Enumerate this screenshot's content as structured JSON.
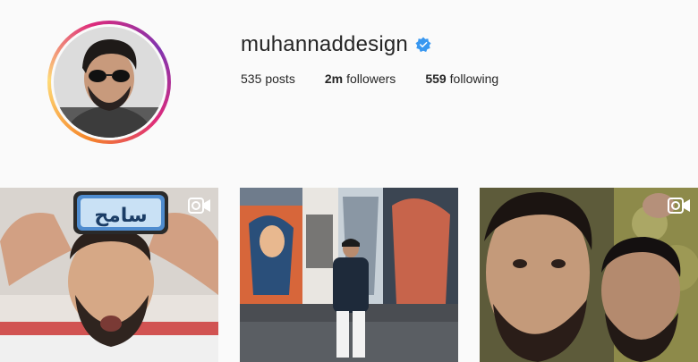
{
  "profile": {
    "username": "muhannaddesign",
    "verified": true,
    "stats": {
      "posts_count": "535",
      "posts_label": "posts",
      "followers_count": "2m",
      "followers_label": "followers",
      "following_count": "559",
      "following_label": "following"
    }
  },
  "posts": [
    {
      "type": "video",
      "overlay_text": "سامح",
      "icon": "video-camera-icon"
    },
    {
      "type": "image",
      "icon": null
    },
    {
      "type": "video",
      "icon": "video-camera-icon"
    }
  ],
  "colors": {
    "background": "#fafafa",
    "text": "#262626",
    "verified_blue": "#3897f0",
    "story_ring": [
      "#f58529",
      "#dd2a7b",
      "#8134af"
    ]
  }
}
